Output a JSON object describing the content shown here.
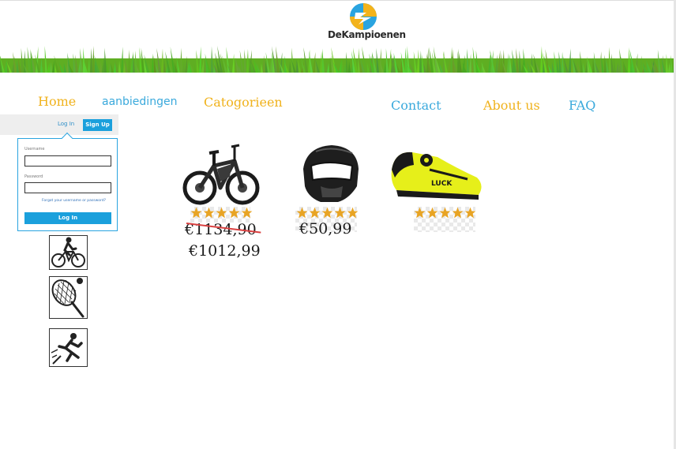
{
  "brand": {
    "name": "DeKampioenen"
  },
  "nav": {
    "home": "Home",
    "offers": "aanbiedingen",
    "categories": "Catogorieen",
    "contact": "Contact",
    "about": "About us",
    "faq": "FAQ"
  },
  "login": {
    "login_link": "Log In",
    "signup_button": "Sign Up",
    "username_label": "Username",
    "password_label": "Password",
    "forgot": "Forgot your username or password?",
    "submit": "Log In"
  },
  "categories": [
    {
      "icon": "cyclist-icon"
    },
    {
      "icon": "tennis-racket-icon"
    },
    {
      "icon": "runner-icon"
    }
  ],
  "products": [
    {
      "name": "e-bike",
      "old_price": "€1134,90",
      "price": "€1012,99",
      "rating": 5
    },
    {
      "name": "helmet",
      "price": "€50,99",
      "rating": 5
    },
    {
      "name": "cycling-shoe",
      "rating": 5
    }
  ],
  "colors": {
    "accent_yellow": "#f0b21c",
    "accent_blue": "#3aa9dc",
    "star": "#e8a424",
    "grass": "#6fbf2a"
  }
}
